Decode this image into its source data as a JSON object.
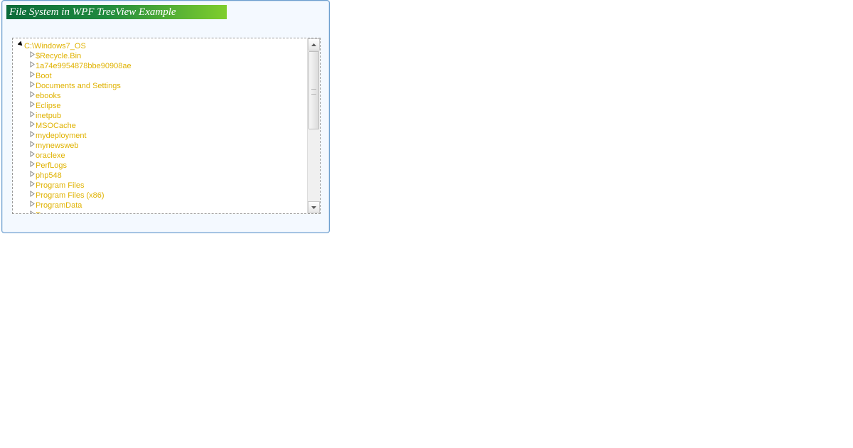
{
  "title": "File System in WPF TreeView Example",
  "tree": {
    "root": {
      "label": "C:\\Windows7_OS",
      "expanded": true,
      "children": [
        {
          "label": "$Recycle.Bin"
        },
        {
          "label": "1a74e9954878bbe90908ae"
        },
        {
          "label": "Boot"
        },
        {
          "label": "Documents and Settings"
        },
        {
          "label": "ebooks"
        },
        {
          "label": "Eclipse"
        },
        {
          "label": "inetpub"
        },
        {
          "label": "MSOCache"
        },
        {
          "label": "mydeployment"
        },
        {
          "label": "mynewsweb"
        },
        {
          "label": "oraclexe"
        },
        {
          "label": "PerfLogs"
        },
        {
          "label": "php548"
        },
        {
          "label": "Program Files"
        },
        {
          "label": "Program Files (x86)"
        },
        {
          "label": "ProgramData"
        },
        {
          "label": "Recovery"
        }
      ]
    }
  },
  "colors": {
    "item": "#e0b200",
    "banner_from": "#0b6b3a",
    "banner_to": "#7fce2d"
  }
}
